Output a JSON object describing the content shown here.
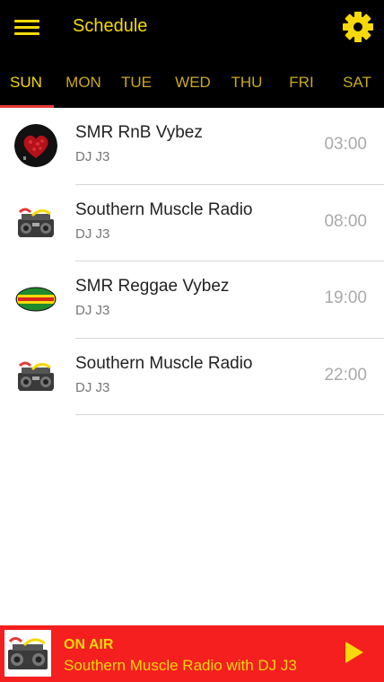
{
  "header": {
    "title": "Schedule",
    "menu_icon": "hamburger-menu-icon",
    "settings_icon": "gear-icon",
    "accent_color": "#f5d90a",
    "background": "#000000"
  },
  "tabs": [
    {
      "label": "SUN",
      "active": true
    },
    {
      "label": "MON",
      "active": false
    },
    {
      "label": "TUE",
      "active": false
    },
    {
      "label": "WED",
      "active": false
    },
    {
      "label": "THU",
      "active": false
    },
    {
      "label": "FRI",
      "active": false
    },
    {
      "label": "SAT",
      "active": false
    }
  ],
  "schedule": [
    {
      "show": "SMR RnB Vybez",
      "host": "DJ J3",
      "time": "03:00",
      "thumb": "rnb-hearts-thumbnail"
    },
    {
      "show": "Southern Muscle Radio",
      "host": "DJ J3",
      "time": "08:00",
      "thumb": "smr-boombox-thumbnail"
    },
    {
      "show": "SMR Reggae Vybez",
      "host": "DJ J3",
      "time": "19:00",
      "thumb": "reggae-thumbnail"
    },
    {
      "show": "Southern Muscle Radio",
      "host": "DJ J3",
      "time": "22:00",
      "thumb": "smr-boombox-thumbnail"
    }
  ],
  "player": {
    "status": "ON AIR",
    "now_playing": "Southern Muscle Radio with DJ J3",
    "play_icon": "play-icon",
    "background": "#f51f1f"
  }
}
